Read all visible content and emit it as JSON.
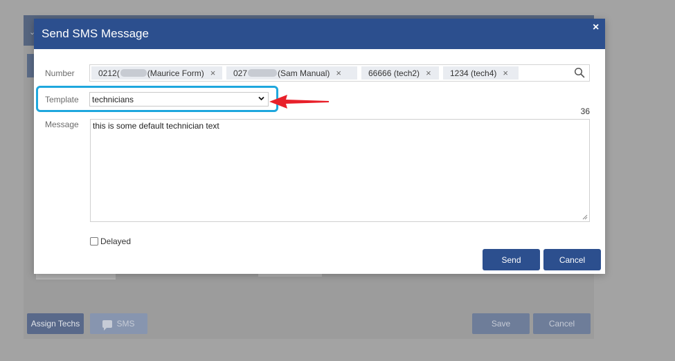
{
  "background": {
    "buttons": {
      "assign_techs": "Assign Techs",
      "sms": "SMS",
      "save": "Save",
      "cancel": "Cancel"
    }
  },
  "modal": {
    "title": "Send SMS Message",
    "close_label": "×",
    "number": {
      "label": "Number",
      "chips": [
        {
          "prefix": "0212(",
          "suffix": " (Maurice Form)"
        },
        {
          "prefix": "027",
          "suffix": " (Sam Manual)"
        },
        {
          "prefix": "",
          "suffix": "66666 (tech2)"
        },
        {
          "prefix": "",
          "suffix": "1234 (tech4)"
        }
      ],
      "remove_glyph": "×",
      "search_icon": "search-icon"
    },
    "template": {
      "label": "Template",
      "selected": "technicians"
    },
    "message": {
      "label": "Message",
      "char_count": "36",
      "text": "this is some default technician text"
    },
    "delayed": {
      "label": "Delayed",
      "checked": false
    },
    "buttons": {
      "send": "Send",
      "cancel": "Cancel"
    }
  },
  "colors": {
    "header": "#2c4f8e",
    "highlight": "#1ea7dd",
    "arrow": "#e8202a"
  }
}
